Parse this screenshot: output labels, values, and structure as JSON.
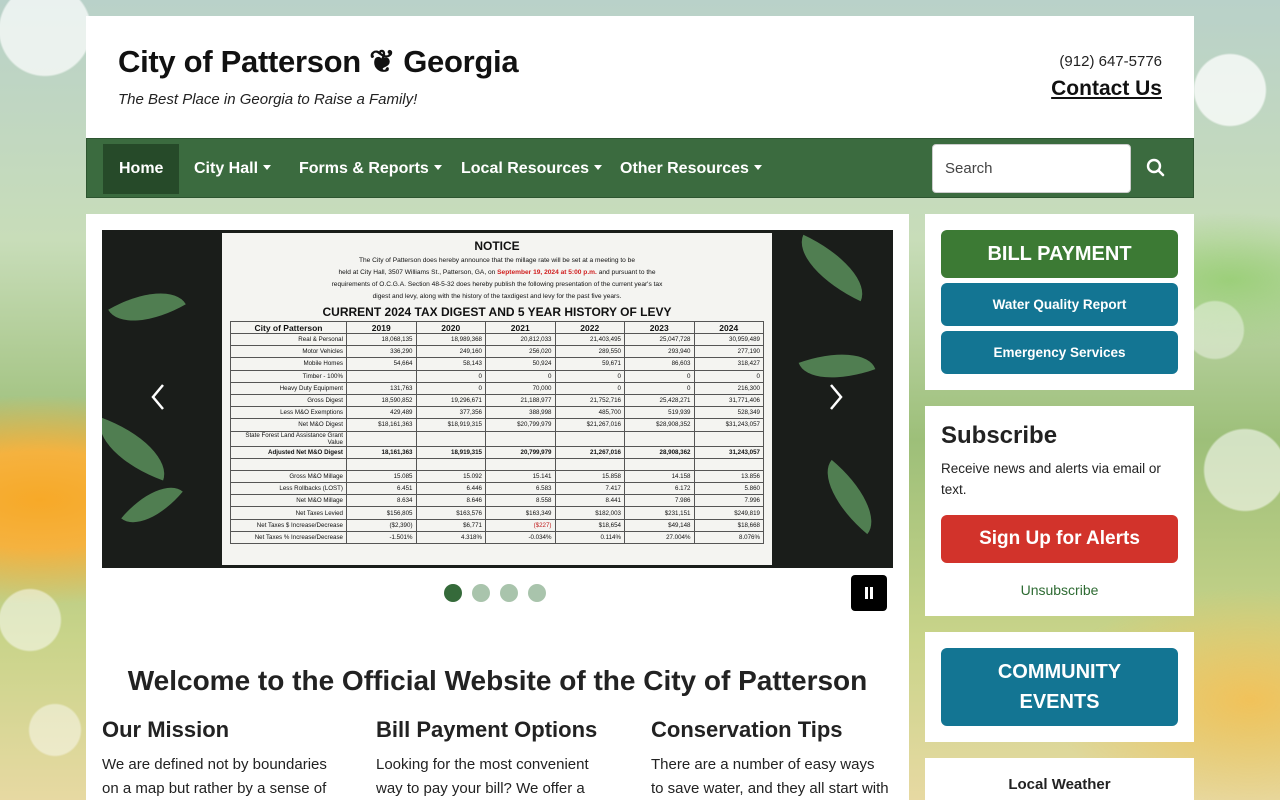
{
  "header": {
    "title": "City of Patterson ❦ Georgia",
    "tagline": "The Best Place in Georgia to Raise a Family!",
    "phone": "(912) 647-5776",
    "contact_label": "Contact Us"
  },
  "nav": {
    "items": [
      {
        "label": "Home"
      },
      {
        "label": "City Hall"
      },
      {
        "label": "Forms & Reports"
      },
      {
        "label": "Local Resources"
      },
      {
        "label": "Other Resources"
      }
    ],
    "search_placeholder": "Search",
    "search_icon": "search-icon"
  },
  "slider": {
    "notice_heading": "NOTICE",
    "notice_text_1": "The City of Patterson does hereby announce that the millage rate will be set at a meeting to be",
    "notice_text_2a": "held at City Hall, 3507 Williams St., Patterson, GA, on ",
    "notice_text_2b": "September 19, 2024 at 5:00 p.m.",
    "notice_text_2c": " and pursuant to the",
    "notice_text_3": "requirements of O.C.G.A. Section 48-5-32 does hereby publish the following presentation of the current year's tax",
    "notice_text_4": "digest and levy, along with the history of the taxdigest and levy for the past five years.",
    "table_title": "CURRENT 2024 TAX DIGEST AND 5 YEAR HISTORY OF LEVY",
    "table_headers": [
      "City of Patterson",
      "2019",
      "2020",
      "2021",
      "2022",
      "2023",
      "2024"
    ],
    "rows": [
      [
        "Real & Personal",
        "18,068,135",
        "18,989,368",
        "20,812,033",
        "21,403,495",
        "25,047,728",
        "30,959,489"
      ],
      [
        "Motor Vehicles",
        "336,290",
        "249,160",
        "256,020",
        "289,550",
        "293,940",
        "277,190"
      ],
      [
        "Mobile Homes",
        "54,664",
        "58,143",
        "50,924",
        "59,671",
        "86,603",
        "318,427"
      ],
      [
        "Timber - 100%",
        "",
        "0",
        "0",
        "0",
        "0",
        "0"
      ],
      [
        "Heavy Duty Equipment",
        "131,763",
        "0",
        "70,000",
        "0",
        "0",
        "216,300"
      ],
      [
        "Gross Digest",
        "18,590,852",
        "19,296,671",
        "21,188,977",
        "21,752,716",
        "25,428,271",
        "31,771,406"
      ],
      [
        "Less M&O Exemptions",
        "429,489",
        "377,356",
        "388,998",
        "485,700",
        "519,939",
        "528,349"
      ],
      [
        "Net M&O Digest",
        "$18,161,363",
        "$18,919,315",
        "$20,799,979",
        "$21,267,016",
        "$28,908,352",
        "$31,243,057"
      ],
      [
        "State Forest Land Assistance Grant Value",
        "",
        "",
        "",
        "",
        "",
        ""
      ],
      [
        "Adjusted Net M&O Digest",
        "18,161,363",
        "18,919,315",
        "20,799,979",
        "21,267,016",
        "28,908,362",
        "31,243,057"
      ],
      [
        "",
        "",
        "",
        "",
        "",
        "",
        ""
      ],
      [
        "Gross M&O Millage",
        "15.085",
        "15.092",
        "15.141",
        "15.858",
        "14.158",
        "13.856"
      ],
      [
        "Less Rollbacks (LOST)",
        "6.451",
        "6.446",
        "6.583",
        "7.417",
        "6.172",
        "5.860"
      ],
      [
        "Net M&O Millage",
        "8.634",
        "8.646",
        "8.558",
        "8.441",
        "7.986",
        "7.996"
      ],
      [
        "Net Taxes Levied",
        "$156,805",
        "$163,576",
        "$163,349",
        "$182,003",
        "$231,151",
        "$249,819"
      ],
      [
        "Net Taxes $ Increase/Decrease",
        "($2,390)",
        "$6,771",
        "($227)",
        "$18,654",
        "$49,148",
        "$18,668"
      ],
      [
        "Net Taxes % Increase/Decrease",
        "-1.501%",
        "4.318%",
        "-0.034%",
        "0.114%",
        "27.004%",
        "8.076%"
      ]
    ],
    "slide_count": 4,
    "active_slide": 1
  },
  "main": {
    "welcome": "Welcome to the Official Website of the City of Patterson",
    "columns": [
      {
        "title": "Our Mission",
        "text": "We are defined not by boundaries on a map but rather by a sense of"
      },
      {
        "title": "Bill Payment Options",
        "text": "Looking for the most convenient way to pay your bill? We offer a"
      },
      {
        "title": "Conservation Tips",
        "text": "There are a number of easy ways to save water, and they all start with"
      }
    ]
  },
  "sidebar": {
    "bill_payment": "BILL PAYMENT",
    "water_quality": "Water Quality Report",
    "emergency": "Emergency Services",
    "subscribe_title": "Subscribe",
    "subscribe_desc": "Receive news and alerts via email or text.",
    "signup": "Sign Up for Alerts",
    "unsubscribe": "Unsubscribe",
    "community_1": "COMMUNITY",
    "community_2": "EVENTS",
    "weather_title": "Local Weather"
  },
  "colors": {
    "nav_green": "#3b6b3f",
    "nav_active": "#264a29",
    "bill_green": "#3c7a34",
    "teal": "#137593",
    "alert_red": "#d2332b"
  }
}
